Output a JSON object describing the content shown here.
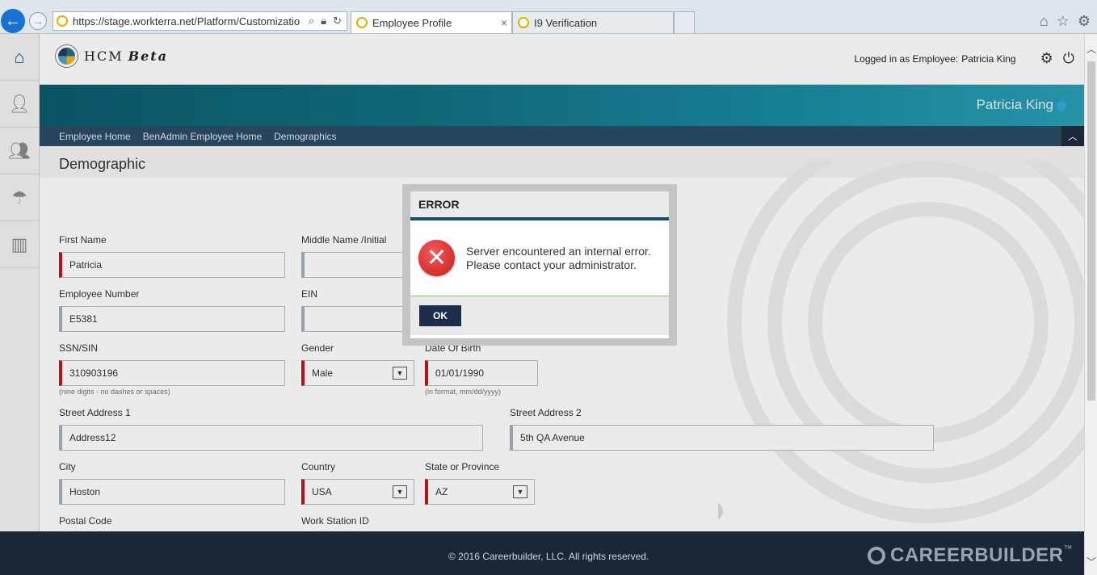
{
  "browser": {
    "url": "https://stage.workterra.net/Platform/Customizatio",
    "tabs": [
      {
        "label": "Employee Profile",
        "close": "×"
      },
      {
        "label": "I9 Verification"
      }
    ],
    "icons": [
      "home-icon",
      "star-icon",
      "gear-icon"
    ]
  },
  "sidebar": {
    "items": [
      {
        "icon": "home-icon"
      },
      {
        "icon": "person-icon"
      },
      {
        "icon": "people-icon"
      },
      {
        "icon": "benefits-umbrella-icon"
      },
      {
        "icon": "bar-chart-icon"
      }
    ]
  },
  "header": {
    "logo_text": "HCM",
    "logo_beta": "Beta",
    "logged_in_label": "Logged in as Employee:",
    "logged_in_user": "Patricia King"
  },
  "banner": {
    "employee_name": "Patricia King"
  },
  "nav": {
    "items": [
      "Employee Home",
      "BenAdmin Employee Home",
      "Demographics"
    ]
  },
  "page": {
    "title": "Demographic"
  },
  "form": {
    "first_name": {
      "label": "First Name",
      "value": "Patricia"
    },
    "middle_name": {
      "label": "Middle Name /Initial",
      "value": ""
    },
    "employee_number": {
      "label": "Employee Number",
      "value": "E5381"
    },
    "ein": {
      "label": "EIN",
      "value": ""
    },
    "ssn": {
      "label": "SSN/SIN",
      "value": "310903196",
      "hint": "(nine digits - no dashes or spaces)"
    },
    "gender": {
      "label": "Gender",
      "value": "Male"
    },
    "dob": {
      "label": "Date Of Birth",
      "value": "01/01/1990",
      "hint": "(in format, mm/dd/yyyy)"
    },
    "street1": {
      "label": "Street Address 1",
      "value": "Address12"
    },
    "street2": {
      "label": "Street Address 2",
      "value": "5th QA Avenue"
    },
    "city": {
      "label": "City",
      "value": "Hoston"
    },
    "country": {
      "label": "Country",
      "value": "USA"
    },
    "state": {
      "label": "State or Province",
      "value": "AZ"
    },
    "postal_code": {
      "label": "Postal Code"
    },
    "work_station": {
      "label": "Work Station ID"
    }
  },
  "modal": {
    "title": "ERROR",
    "message_line1": "Server encountered an internal error.",
    "message_line2": "Please contact your administrator.",
    "ok_label": "OK"
  },
  "footer": {
    "copyright": "© 2016 Careerbuilder, LLC. All rights reserved.",
    "brand": "CAREERBUILDER",
    "brand_tm": "™"
  },
  "colors": {
    "required_marker": "#c4161c",
    "nav_strip": "#2b4c66",
    "footer_bg": "#1b2737",
    "ok_button": "#1d2d4d",
    "modal_accent": "#1c4c68"
  }
}
